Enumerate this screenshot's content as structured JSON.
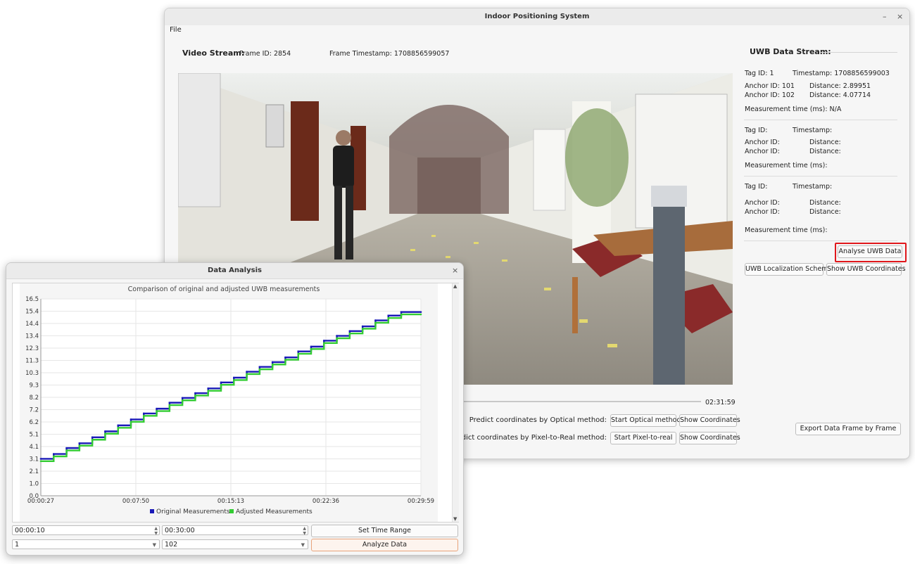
{
  "main_window": {
    "title": "Indoor Positioning System",
    "minimize": "–",
    "close": "×",
    "menu_file": "File",
    "video_stream_label": "Video Stream:",
    "frame_id": "Frame ID: 2854",
    "frame_timestamp": "Frame Timestamp: 1708856599057",
    "video_end_time": "02:31:59",
    "predict_optical_label": "Predict coordinates by Optical method:",
    "predict_pixel_label": "Predict coordinates by Pixel-to-Real method:",
    "start_optical_button": "Start Optical method",
    "start_pixel_button": "Start Pixel-to-real",
    "show_coordinates_1": "Show Coordinates",
    "show_coordinates_2": "Show Coordinates"
  },
  "uwb_panel": {
    "title": "UWB Data Stream:",
    "blocks": [
      {
        "tag": "Tag ID: 1",
        "timestamp": "Timestamp: 1708856599003",
        "anchor1": "Anchor ID: 101",
        "dist1": "Distance: 2.89951",
        "anchor2": "Anchor ID: 102",
        "dist2": "Distance: 4.07714",
        "measure": "Measurement time (ms): N/A"
      },
      {
        "tag": "Tag ID:",
        "timestamp": "Timestamp:",
        "anchor1": "Anchor ID:",
        "dist1": "Distance:",
        "anchor2": "Anchor ID:",
        "dist2": "Distance:",
        "measure": "Measurement time (ms):"
      },
      {
        "tag": "Tag ID:",
        "timestamp": "Timestamp:",
        "anchor1": "Anchor ID:",
        "dist1": "Distance:",
        "anchor2": "Anchor ID:",
        "dist2": "Distance:",
        "measure": "Measurement time (ms):"
      }
    ],
    "analyse_button": "Analyse UWB Data",
    "schema_button": "UWB Localization Schema",
    "show_uwb_button": "Show UWB Coordinates",
    "export_button": "Export Data Frame by Frame"
  },
  "dialog": {
    "title": "Data Analysis",
    "close": "×",
    "start_time": "00:00:10",
    "end_time": "00:30:00",
    "set_range_button": "Set Time Range",
    "tag_select": "1",
    "anchor_select": "102",
    "analyze_button": "Analyze Data"
  },
  "colors": {
    "original": "#1a1ab8",
    "adjusted": "#33cc33",
    "highlight": "#e0171b"
  },
  "chart_data": {
    "type": "line",
    "title": "Comparison of original and adjusted UWB measurements",
    "xlabel": "",
    "ylabel": "",
    "x_ticks": [
      "00:00:27",
      "00:07:50",
      "00:15:13",
      "00:22:36",
      "00:29:59"
    ],
    "y_ticks": [
      "0.0",
      "1.0",
      "2.1",
      "3.1",
      "4.1",
      "5.1",
      "6.2",
      "7.2",
      "8.2",
      "9.3",
      "10.3",
      "11.3",
      "12.3",
      "13.4",
      "14.4",
      "15.4",
      "16.5"
    ],
    "ylim": [
      0,
      16.5
    ],
    "x_minutes": [
      0.45,
      29.98
    ],
    "grid": true,
    "legend": "bottom",
    "series": [
      {
        "name": "Original Measurements",
        "step_x_minutes": [
          0.45,
          1.45,
          2.45,
          3.45,
          4.45,
          5.45,
          6.45,
          7.45,
          8.45,
          9.45,
          10.45,
          11.45,
          12.45,
          13.45,
          14.45,
          15.45,
          16.45,
          17.45,
          18.45,
          19.45,
          20.45,
          21.45,
          22.45,
          23.45,
          24.45,
          25.45,
          26.45,
          27.45,
          28.45,
          29.98
        ],
        "values": [
          3.1,
          3.5,
          4.0,
          4.4,
          4.9,
          5.4,
          5.9,
          6.4,
          6.9,
          7.3,
          7.8,
          8.2,
          8.6,
          9.0,
          9.5,
          9.9,
          10.4,
          10.8,
          11.2,
          11.6,
          12.1,
          12.5,
          13.0,
          13.4,
          13.8,
          14.2,
          14.7,
          15.1,
          15.4,
          15.4
        ]
      },
      {
        "name": "Adjusted Measurements",
        "step_x_minutes": [
          0.45,
          1.45,
          2.45,
          3.45,
          4.45,
          5.45,
          6.45,
          7.45,
          8.45,
          9.45,
          10.45,
          11.45,
          12.45,
          13.45,
          14.45,
          15.45,
          16.45,
          17.45,
          18.45,
          19.45,
          20.45,
          21.45,
          22.45,
          23.45,
          24.45,
          25.45,
          26.45,
          27.45,
          28.45,
          29.98
        ],
        "values": [
          2.9,
          3.3,
          3.8,
          4.2,
          4.7,
          5.2,
          5.7,
          6.2,
          6.7,
          7.1,
          7.6,
          8.0,
          8.4,
          8.8,
          9.3,
          9.7,
          10.2,
          10.6,
          11.0,
          11.4,
          11.9,
          12.3,
          12.8,
          13.2,
          13.6,
          14.0,
          14.5,
          14.9,
          15.2,
          15.2
        ]
      }
    ]
  }
}
